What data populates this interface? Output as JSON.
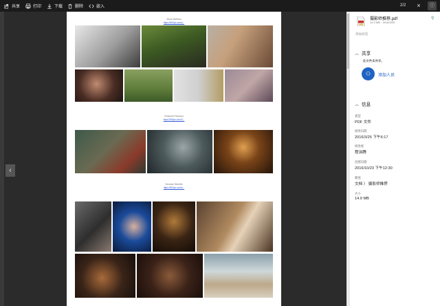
{
  "toolbar": {
    "share": "共享",
    "print": "打印",
    "download": "下载",
    "delete": "删除",
    "embed": "嵌入",
    "page_indicator": "2/2",
    "close": "×",
    "info": "ⓘ"
  },
  "document": {
    "sections": [
      {
        "name": "Steve McElhan",
        "link": "https://500px.com/s..."
      },
      {
        "name": "Zeremiah Fitzsimon",
        "link": "https://500px.com/Z..."
      },
      {
        "name": "Kerusian Nikolidis",
        "link": "https://500px.com/k..."
      }
    ]
  },
  "panel": {
    "file_name": "摄影师推荐.pdf",
    "file_meta": "14.9 MB · 2016/3/25",
    "add_tag": "添加标签",
    "share_title": "共享",
    "share_desc": "此文件未共享。",
    "add_person": "添加人员",
    "info_title": "信息",
    "fields": [
      {
        "label": "类型",
        "value": "PDF 文件"
      },
      {
        "label": "修改日期",
        "value": "2016/3/25 下午6:17"
      },
      {
        "label": "修改者",
        "value": "程涂腾"
      },
      {
        "label": "创建日期",
        "value": "2016/10/23 下午12:30"
      },
      {
        "label": "路径",
        "value": "文档 〉 摄影师推荐"
      },
      {
        "label": "大小",
        "value": "14.9 MB"
      }
    ]
  }
}
